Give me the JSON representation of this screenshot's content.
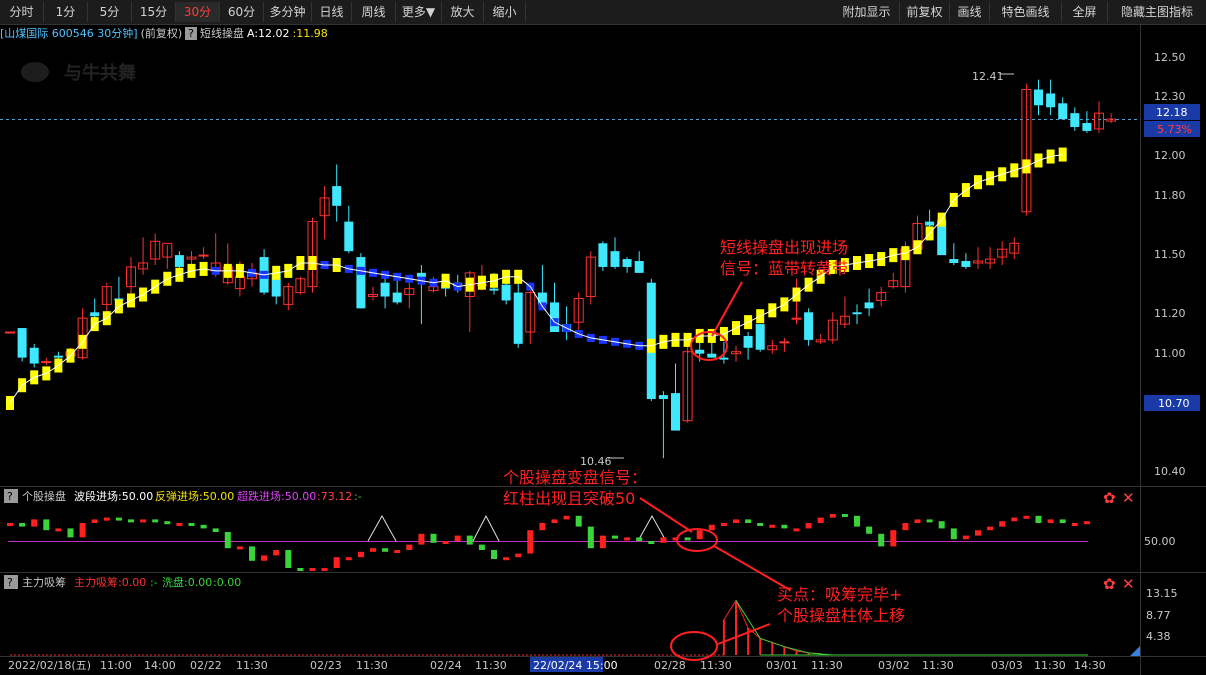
{
  "toolbar": {
    "left": [
      "分时",
      "1分",
      "5分",
      "15分",
      "30分",
      "60分",
      "多分钟",
      "日线",
      "周线",
      "更多▼",
      "放大",
      "缩小"
    ],
    "active": "30分",
    "right": [
      "附加显示",
      "前复权",
      "画线",
      "特色画线",
      "全屏",
      "隐藏主图指标"
    ]
  },
  "legend": {
    "stock": "[山煤国际 600546 30分钟]",
    "adj": "(前复权)",
    "help": "?",
    "indicator": "短线操盘",
    "a_label": "A:12.02",
    "b_label": ":11.98"
  },
  "watermark": "与牛共舞",
  "price_axis": {
    "ticks": [
      "12.50",
      "12.30",
      "12.00",
      "11.80",
      "11.50",
      "11.20",
      "11.00",
      "10.70",
      "10.40"
    ],
    "current": "12.18",
    "change": "5.73%",
    "low_box": "10.70"
  },
  "high_label": "12.41",
  "low_label": "10.46",
  "panel2": {
    "help": "?",
    "name": "个股操盘",
    "l1": "波段进场:50.00",
    "l2": "反弹进场:50.00",
    "l3": "超跌进场:50.00",
    "l4": ":73.12",
    "l5": ":-",
    "axis": "50.00"
  },
  "panel3": {
    "help": "?",
    "name": "主力吸筹",
    "l1": "主力吸筹:0.00",
    "l2": ":-",
    "l3": "洗盘:0.00",
    "l4": ":0.00",
    "axis": [
      "13.15",
      "8.77",
      "4.38"
    ]
  },
  "xaxis": [
    "2022/02/18(五)",
    "11:00",
    "14:00",
    "02/22",
    "11:30",
    "02/23",
    "11:30",
    "02/24",
    "11:30",
    "02/28",
    "11:30",
    "03/01",
    "11:30",
    "03/02",
    "11:30",
    "03/03",
    "11:30",
    "14:30"
  ],
  "xaxis_cursor": "22/02/24 15:00",
  "annotations": {
    "a1_l1": "短线操盘出现进场",
    "a1_l2": "信号：蓝带转黄带",
    "a2_l1": "个股操盘变盘信号：",
    "a2_l2": "红柱出现且突破50",
    "a3_l1": "买点：吸筹完毕+",
    "a3_l2": "个股操盘柱体上移"
  },
  "chart_data": {
    "type": "candlestick",
    "series": [
      {
        "name": "K线",
        "ohlc": [
          [
            11.1,
            11.1,
            11.1,
            11.1
          ],
          [
            11.12,
            11.12,
            10.95,
            10.97
          ],
          [
            11.02,
            11.04,
            10.92,
            10.94
          ],
          [
            10.95,
            10.97,
            10.93,
            10.95
          ],
          [
            10.98,
            11.0,
            10.96,
            10.97
          ],
          [
            10.98,
            11.02,
            10.96,
            11.0
          ],
          [
            10.97,
            11.22,
            10.96,
            11.17
          ],
          [
            11.2,
            11.27,
            11.14,
            11.18
          ],
          [
            11.24,
            11.35,
            11.2,
            11.33
          ],
          [
            11.27,
            11.38,
            11.24,
            11.26
          ],
          [
            11.33,
            11.48,
            11.29,
            11.43
          ],
          [
            11.42,
            11.58,
            11.39,
            11.45
          ],
          [
            11.47,
            11.6,
            11.44,
            11.56
          ],
          [
            11.48,
            11.54,
            11.42,
            11.55
          ],
          [
            11.49,
            11.51,
            11.4,
            11.43
          ],
          [
            11.47,
            11.51,
            11.43,
            11.48
          ],
          [
            11.49,
            11.53,
            11.47,
            11.49
          ],
          [
            11.41,
            11.6,
            11.38,
            11.45
          ],
          [
            11.35,
            11.55,
            11.34,
            11.43
          ],
          [
            11.32,
            11.46,
            11.28,
            11.38
          ],
          [
            11.37,
            11.45,
            11.33,
            11.4
          ],
          [
            11.48,
            11.52,
            11.29,
            11.3
          ],
          [
            11.4,
            11.43,
            11.24,
            11.28
          ],
          [
            11.24,
            11.35,
            11.21,
            11.33
          ],
          [
            11.3,
            11.38,
            11.29,
            11.37
          ],
          [
            11.33,
            11.68,
            11.3,
            11.66
          ],
          [
            11.69,
            11.84,
            11.57,
            11.78
          ],
          [
            11.84,
            11.95,
            11.66,
            11.74
          ],
          [
            11.66,
            11.74,
            11.5,
            11.51
          ],
          [
            11.48,
            11.5,
            11.22,
            11.22
          ],
          [
            11.28,
            11.33,
            11.26,
            11.29
          ],
          [
            11.35,
            11.39,
            11.22,
            11.28
          ],
          [
            11.3,
            11.36,
            11.24,
            11.25
          ],
          [
            11.29,
            11.38,
            11.22,
            11.32
          ],
          [
            11.4,
            11.44,
            11.14,
            11.38
          ],
          [
            11.31,
            11.38,
            11.3,
            11.33
          ],
          [
            11.36,
            11.38,
            11.28,
            11.32
          ],
          [
            11.35,
            11.39,
            11.3,
            11.33
          ],
          [
            11.28,
            11.41,
            11.1,
            11.4
          ],
          [
            11.34,
            11.44,
            11.31,
            11.34
          ],
          [
            11.32,
            11.4,
            11.29,
            11.31
          ],
          [
            11.34,
            11.38,
            11.24,
            11.26
          ],
          [
            11.3,
            11.36,
            11.02,
            11.04
          ],
          [
            11.1,
            11.34,
            11.04,
            11.3
          ],
          [
            11.3,
            11.44,
            11.22,
            11.24
          ],
          [
            11.25,
            11.35,
            11.1,
            11.1
          ],
          [
            11.14,
            11.23,
            11.06,
            11.1
          ],
          [
            11.15,
            11.3,
            11.1,
            11.27
          ],
          [
            11.28,
            11.51,
            11.24,
            11.48
          ],
          [
            11.55,
            11.56,
            11.41,
            11.43
          ],
          [
            11.51,
            11.58,
            11.42,
            11.43
          ],
          [
            11.47,
            11.48,
            11.4,
            11.43
          ],
          [
            11.46,
            11.51,
            11.4,
            11.4
          ],
          [
            11.35,
            11.37,
            10.75,
            10.76
          ],
          [
            10.78,
            10.8,
            10.46,
            10.76
          ],
          [
            10.79,
            10.94,
            10.6,
            10.6
          ],
          [
            10.65,
            11.04,
            10.64,
            11.0
          ],
          [
            11.01,
            11.08,
            10.95,
            10.99
          ],
          [
            10.99,
            11.06,
            10.97,
            10.97
          ],
          [
            10.97,
            11.05,
            10.94,
            10.96
          ],
          [
            10.99,
            11.03,
            10.95,
            11.0
          ],
          [
            11.08,
            11.1,
            10.96,
            11.02
          ],
          [
            11.14,
            11.14,
            11.0,
            11.01
          ],
          [
            11.01,
            11.06,
            10.99,
            11.03
          ],
          [
            11.05,
            11.07,
            11.0,
            11.05
          ],
          [
            11.17,
            11.37,
            11.14,
            11.17
          ],
          [
            11.2,
            11.22,
            11.03,
            11.06
          ],
          [
            11.05,
            11.09,
            11.04,
            11.06
          ],
          [
            11.06,
            11.2,
            11.04,
            11.16
          ],
          [
            11.14,
            11.28,
            11.12,
            11.18
          ],
          [
            11.2,
            11.24,
            11.14,
            11.19
          ],
          [
            11.25,
            11.32,
            11.18,
            11.22
          ],
          [
            11.26,
            11.33,
            11.23,
            11.3
          ],
          [
            11.33,
            11.4,
            11.32,
            11.36
          ],
          [
            11.33,
            11.56,
            11.3,
            11.52
          ],
          [
            11.52,
            11.69,
            11.5,
            11.65
          ],
          [
            11.66,
            11.72,
            11.61,
            11.64
          ],
          [
            11.67,
            11.69,
            11.49,
            11.49
          ],
          [
            11.47,
            11.55,
            11.44,
            11.45
          ],
          [
            11.46,
            11.5,
            11.42,
            11.43
          ],
          [
            11.45,
            11.53,
            11.42,
            11.46
          ],
          [
            11.45,
            11.53,
            11.42,
            11.47
          ],
          [
            11.48,
            11.56,
            11.44,
            11.52
          ],
          [
            11.5,
            11.58,
            11.47,
            11.55
          ],
          [
            11.71,
            12.36,
            11.69,
            12.33
          ],
          [
            12.33,
            12.38,
            12.2,
            12.25
          ],
          [
            12.31,
            12.38,
            12.2,
            12.24
          ],
          [
            12.26,
            12.29,
            12.18,
            12.18
          ],
          [
            12.21,
            12.24,
            12.12,
            12.14
          ],
          [
            12.16,
            12.22,
            12.11,
            12.12
          ],
          [
            12.13,
            12.27,
            12.11,
            12.21
          ],
          [
            12.17,
            12.21,
            12.16,
            12.18
          ]
        ]
      },
      {
        "name": "短线操盘",
        "values": [
          10.74,
          10.83,
          10.87,
          10.89,
          10.93,
          10.98,
          11.05,
          11.14,
          11.17,
          11.23,
          11.26,
          11.29,
          11.33,
          11.37,
          11.39,
          11.41,
          11.42,
          11.41,
          11.41,
          11.41,
          11.4,
          11.39,
          11.4,
          11.41,
          11.45,
          11.45,
          11.44,
          11.44,
          11.42,
          11.41,
          11.4,
          11.39,
          11.38,
          11.37,
          11.36,
          11.35,
          11.36,
          11.33,
          11.34,
          11.35,
          11.36,
          11.38,
          11.38,
          11.33,
          11.23,
          11.15,
          11.12,
          11.09,
          11.07,
          11.06,
          11.05,
          11.04,
          11.03,
          11.03,
          11.05,
          11.06,
          11.06,
          11.08,
          11.08,
          11.09,
          11.12,
          11.15,
          11.18,
          11.21,
          11.24,
          11.29,
          11.34,
          11.38,
          11.43,
          11.44,
          11.45,
          11.46,
          11.47,
          11.49,
          11.5,
          11.53,
          11.6,
          11.67,
          11.77,
          11.82,
          11.86,
          11.88,
          11.9,
          11.92,
          11.94,
          11.97,
          11.99,
          12.0
        ]
      },
      {
        "name": "个股操盘",
        "values": [
          60,
          58,
          62,
          56,
          57,
          52,
          60,
          62,
          63,
          62,
          61,
          62,
          61,
          60,
          60,
          59,
          57,
          55,
          46,
          47,
          39,
          42,
          45,
          35,
          34,
          35,
          35,
          41,
          41,
          44,
          46,
          44,
          45,
          48,
          54,
          49,
          50,
          53,
          48,
          45,
          40,
          41,
          43,
          56,
          60,
          62,
          64,
          58,
          46,
          53,
          52,
          52,
          50,
          49,
          52,
          52,
          51,
          56,
          59,
          60,
          62,
          60,
          59,
          59,
          57,
          57,
          60,
          63,
          65,
          64,
          58,
          54,
          47,
          56,
          60,
          62,
          61,
          57,
          51,
          53,
          56,
          58,
          61,
          63,
          64,
          60,
          62,
          60,
          60,
          61
        ]
      },
      {
        "name": "主力吸筹",
        "values": [
          0,
          0,
          0,
          0,
          0,
          0,
          0,
          0,
          0,
          0,
          0,
          0,
          0,
          0,
          0,
          0,
          0,
          0,
          0,
          0,
          0,
          0,
          0,
          0,
          0,
          0,
          0,
          0,
          0,
          0,
          0,
          0,
          0,
          0,
          0,
          0,
          0,
          0,
          0,
          0,
          0,
          0,
          0,
          0,
          0,
          0,
          0,
          0,
          0,
          0,
          0,
          0,
          0,
          0,
          0,
          0,
          0,
          0,
          0,
          8.5,
          13.15,
          6.5,
          4,
          3,
          2,
          1,
          0.5,
          0.3,
          0,
          0,
          0,
          0,
          0,
          0,
          0,
          0,
          0,
          0,
          0,
          0,
          0,
          0,
          0,
          0,
          0,
          0,
          0,
          0,
          0,
          0,
          0
        ]
      }
    ],
    "ylim": [
      10.4,
      12.6
    ],
    "grid": false
  }
}
